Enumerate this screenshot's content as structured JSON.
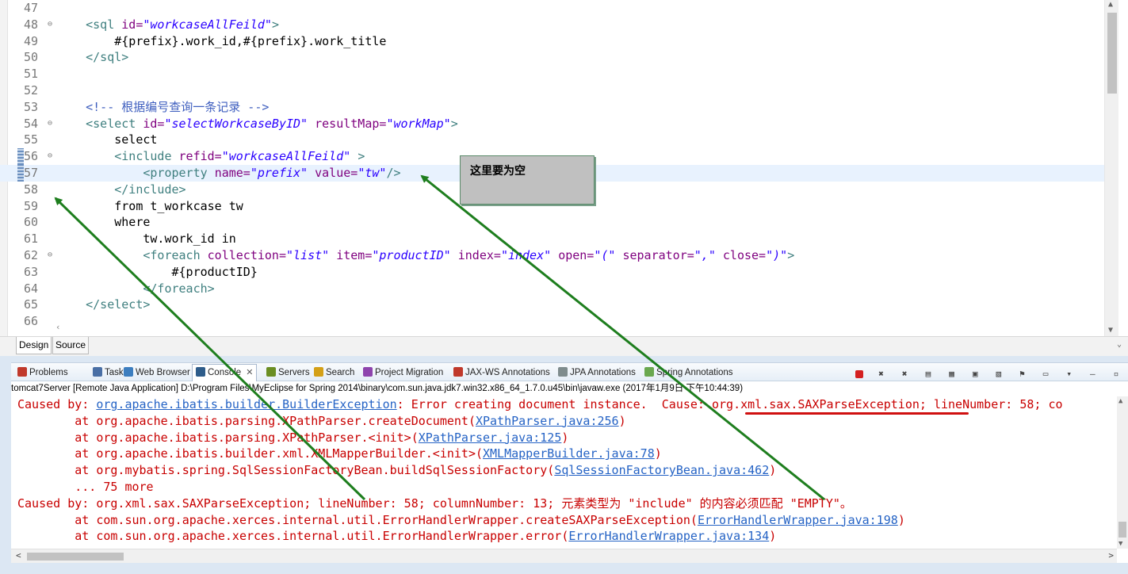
{
  "editor": {
    "lines": [
      {
        "num": "47",
        "fold": false,
        "marker": false,
        "current": false,
        "parts": []
      },
      {
        "num": "48",
        "fold": true,
        "marker": false,
        "current": false,
        "parts": [
          [
            "",
            "    "
          ],
          [
            "tg",
            "<sql "
          ],
          [
            "at",
            "id="
          ],
          [
            "av",
            "\"workcaseAllFeild\""
          ],
          [
            "tg",
            ">"
          ]
        ]
      },
      {
        "num": "49",
        "fold": false,
        "marker": false,
        "current": false,
        "parts": [
          [
            "",
            "        #{prefix}.work_id,#{prefix}.work_title"
          ]
        ]
      },
      {
        "num": "50",
        "fold": false,
        "marker": false,
        "current": false,
        "parts": [
          [
            "",
            "    "
          ],
          [
            "tg",
            "</sql>"
          ]
        ]
      },
      {
        "num": "51",
        "fold": false,
        "marker": false,
        "current": false,
        "parts": []
      },
      {
        "num": "52",
        "fold": false,
        "marker": false,
        "current": false,
        "parts": []
      },
      {
        "num": "53",
        "fold": false,
        "marker": false,
        "current": false,
        "parts": [
          [
            "",
            "    "
          ],
          [
            "cm",
            "<!-- 根据编号查询一条记录 -->"
          ]
        ]
      },
      {
        "num": "54",
        "fold": true,
        "marker": false,
        "current": false,
        "parts": [
          [
            "",
            "    "
          ],
          [
            "tg",
            "<select "
          ],
          [
            "at",
            "id="
          ],
          [
            "av",
            "\"selectWorkcaseByID\""
          ],
          [
            "",
            " "
          ],
          [
            "at",
            "resultMap="
          ],
          [
            "av",
            "\"workMap\""
          ],
          [
            "tg",
            ">"
          ]
        ]
      },
      {
        "num": "55",
        "fold": false,
        "marker": false,
        "current": false,
        "parts": [
          [
            "",
            "        select"
          ]
        ]
      },
      {
        "num": "56",
        "fold": true,
        "marker": true,
        "current": false,
        "parts": [
          [
            "",
            "        "
          ],
          [
            "tg",
            "<include "
          ],
          [
            "at",
            "refid="
          ],
          [
            "av",
            "\"workcaseAllFeild\""
          ],
          [
            "",
            " "
          ],
          [
            "tg",
            ">"
          ]
        ]
      },
      {
        "num": "57",
        "fold": false,
        "marker": true,
        "current": true,
        "parts": [
          [
            "",
            "            "
          ],
          [
            "tg",
            "<property "
          ],
          [
            "at",
            "name="
          ],
          [
            "av",
            "\"prefix\""
          ],
          [
            "",
            " "
          ],
          [
            "at",
            "value="
          ],
          [
            "av",
            "\"tw\""
          ],
          [
            "tg",
            "/>"
          ]
        ]
      },
      {
        "num": "58",
        "fold": false,
        "marker": false,
        "current": false,
        "parts": [
          [
            "",
            "        "
          ],
          [
            "tg",
            "</include>"
          ]
        ]
      },
      {
        "num": "59",
        "fold": false,
        "marker": false,
        "current": false,
        "parts": [
          [
            "",
            "        from t_workcase tw"
          ]
        ]
      },
      {
        "num": "60",
        "fold": false,
        "marker": false,
        "current": false,
        "parts": [
          [
            "",
            "        where"
          ]
        ]
      },
      {
        "num": "61",
        "fold": false,
        "marker": false,
        "current": false,
        "parts": [
          [
            "",
            "            tw.work_id in"
          ]
        ]
      },
      {
        "num": "62",
        "fold": true,
        "marker": false,
        "current": false,
        "parts": [
          [
            "",
            "            "
          ],
          [
            "tg",
            "<foreach "
          ],
          [
            "at",
            "collection="
          ],
          [
            "av",
            "\"list\""
          ],
          [
            "",
            " "
          ],
          [
            "at",
            "item="
          ],
          [
            "av",
            "\"productID\""
          ],
          [
            "",
            " "
          ],
          [
            "at",
            "index="
          ],
          [
            "av",
            "\"index\""
          ],
          [
            "",
            " "
          ],
          [
            "at",
            "open="
          ],
          [
            "av",
            "\"(\""
          ],
          [
            "",
            " "
          ],
          [
            "at",
            "separator="
          ],
          [
            "av",
            "\",\""
          ],
          [
            "",
            " "
          ],
          [
            "at",
            "close="
          ],
          [
            "av",
            "\")\""
          ],
          [
            "tg",
            ">"
          ]
        ]
      },
      {
        "num": "63",
        "fold": false,
        "marker": false,
        "current": false,
        "parts": [
          [
            "",
            "                #{productID}"
          ]
        ]
      },
      {
        "num": "64",
        "fold": false,
        "marker": false,
        "current": false,
        "parts": [
          [
            "",
            "            "
          ],
          [
            "tg",
            "</foreach>"
          ]
        ]
      },
      {
        "num": "65",
        "fold": false,
        "marker": false,
        "current": false,
        "parts": [
          [
            "",
            "    "
          ],
          [
            "tg",
            "</select>"
          ]
        ]
      },
      {
        "num": "66",
        "fold": false,
        "marker": false,
        "current": false,
        "parts": []
      }
    ]
  },
  "editor_tabs": {
    "design": "Design",
    "source": "Source"
  },
  "views": [
    {
      "label": "Problems",
      "icon": "problems-icon",
      "color": "#c0392b",
      "active": false
    },
    {
      "label": "Tasks",
      "icon": "tasks-icon",
      "color": "#4a6fa5",
      "active": false
    },
    {
      "label": "Web Browser",
      "icon": "web-browser-icon",
      "color": "#3d7ebf",
      "active": false
    },
    {
      "label": "Console",
      "icon": "console-icon",
      "color": "#2e5c8a",
      "active": true
    },
    {
      "label": "Servers",
      "icon": "servers-icon",
      "color": "#6b8e23",
      "active": false
    },
    {
      "label": "Search",
      "icon": "search-icon",
      "color": "#d4a017",
      "active": false
    },
    {
      "label": "Project Migration",
      "icon": "project-migration-icon",
      "color": "#8e44ad",
      "active": false
    },
    {
      "label": "JAX-WS Annotations",
      "icon": "jaxws-annotations-icon",
      "color": "#c0392b",
      "active": false
    },
    {
      "label": "JPA Annotations",
      "icon": "jpa-annotations-icon",
      "color": "#7f8c8d",
      "active": false
    },
    {
      "label": "Spring Annotations",
      "icon": "spring-annotations-icon",
      "color": "#6aa84f",
      "active": false
    }
  ],
  "console": {
    "header": "tomcat7Server [Remote Java Application] D:\\Program Files\\MyEclipse for Spring 2014\\binary\\com.sun.java.jdk7.win32.x86_64_1.7.0.u45\\bin\\javaw.exe (2017年1月9日 下午10:44:39)",
    "lines": [
      [
        [
          "err",
          "Caused by: "
        ],
        [
          "link",
          "org.apache.ibatis.builder.BuilderException"
        ],
        [
          "err",
          ": Error creating document instance.  Cause: org.xml.sax.SAXParseException; lineNumber: 58; co"
        ]
      ],
      [
        [
          "err",
          "\tat org.apache.ibatis.parsing.XPathParser.createDocument("
        ],
        [
          "link",
          "XPathParser.java:256"
        ],
        [
          "err",
          ")"
        ]
      ],
      [
        [
          "err",
          "\tat org.apache.ibatis.parsing.XPathParser.<init>("
        ],
        [
          "link",
          "XPathParser.java:125"
        ],
        [
          "err",
          ")"
        ]
      ],
      [
        [
          "err",
          "\tat org.apache.ibatis.builder.xml.XMLMapperBuilder.<init>("
        ],
        [
          "link",
          "XMLMapperBuilder.java:78"
        ],
        [
          "err",
          ")"
        ]
      ],
      [
        [
          "err",
          "\tat org.mybatis.spring.SqlSessionFactoryBean.buildSqlSessionFactory("
        ],
        [
          "link",
          "SqlSessionFactoryBean.java:462"
        ],
        [
          "err",
          ")"
        ]
      ],
      [
        [
          "err",
          "\t... 75 more"
        ]
      ],
      [
        [
          "err",
          "Caused by: org.xml.sax.SAXParseException; lineNumber: 58; columnNumber: 13; 元素类型为 \"include\" 的内容必须匹配 \"EMPTY\"。"
        ]
      ],
      [
        [
          "err",
          "\tat com.sun.org.apache.xerces.internal.util.ErrorHandlerWrapper.createSAXParseException("
        ],
        [
          "link",
          "ErrorHandlerWrapper.java:198"
        ],
        [
          "err",
          ")"
        ]
      ],
      [
        [
          "err",
          "\tat com.sun.org.apache.xerces.internal.util.ErrorHandlerWrapper.error("
        ],
        [
          "link",
          "ErrorHandlerWrapper.java:134"
        ],
        [
          "err",
          ")"
        ]
      ]
    ]
  },
  "annotation": {
    "callout_text": "这里要为空"
  },
  "colors": {
    "tag": "#3f7f7f",
    "attr": "#7f007f",
    "value": "#2a00ff",
    "comment": "#3f5fbf",
    "console_error": "#c80000",
    "console_link": "#2563c5",
    "annotation_arrow": "#1e7e1e",
    "error_underline": "#d01010"
  }
}
